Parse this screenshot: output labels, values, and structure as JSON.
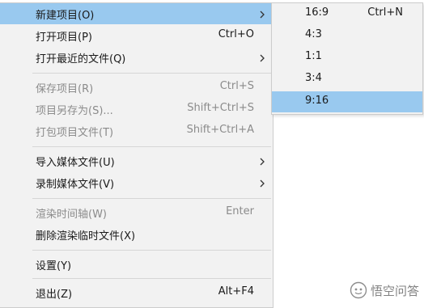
{
  "main_menu": [
    {
      "label": "新建项目(O)",
      "shortcut": "",
      "submenu": true,
      "state": "highlight"
    },
    {
      "label": "打开项目(P)",
      "shortcut": "Ctrl+O",
      "submenu": false,
      "state": "normal"
    },
    {
      "label": "打开最近的文件(Q)",
      "shortcut": "",
      "submenu": true,
      "state": "normal"
    },
    {
      "label": "保存项目(R)",
      "shortcut": "Ctrl+S",
      "submenu": false,
      "state": "disabled"
    },
    {
      "label": "项目另存为(S)...",
      "shortcut": "Shift+Ctrl+S",
      "submenu": false,
      "state": "disabled"
    },
    {
      "label": "打包项目文件(T)",
      "shortcut": "Shift+Ctrl+A",
      "submenu": false,
      "state": "disabled"
    },
    {
      "label": "导入媒体文件(U)",
      "shortcut": "",
      "submenu": true,
      "state": "normal"
    },
    {
      "label": "录制媒体文件(V)",
      "shortcut": "",
      "submenu": true,
      "state": "normal"
    },
    {
      "label": "渲染时间轴(W)",
      "shortcut": "Enter",
      "submenu": false,
      "state": "disabled"
    },
    {
      "label": "删除渲染临时文件(X)",
      "shortcut": "",
      "submenu": false,
      "state": "normal"
    },
    {
      "label": "设置(Y)",
      "shortcut": "",
      "submenu": false,
      "state": "normal"
    },
    {
      "label": "退出(Z)",
      "shortcut": "Alt+F4",
      "submenu": false,
      "state": "normal"
    }
  ],
  "submenu": [
    {
      "label": "16:9",
      "shortcut": "Ctrl+N",
      "state": "normal"
    },
    {
      "label": "4:3",
      "shortcut": "",
      "state": "normal"
    },
    {
      "label": "1:1",
      "shortcut": "",
      "state": "normal"
    },
    {
      "label": "3:4",
      "shortcut": "",
      "state": "normal"
    },
    {
      "label": "9:16",
      "shortcut": "",
      "state": "highlight"
    }
  ],
  "watermark": {
    "text": "悟空问答",
    "icon": "watermark-logo-icon"
  }
}
